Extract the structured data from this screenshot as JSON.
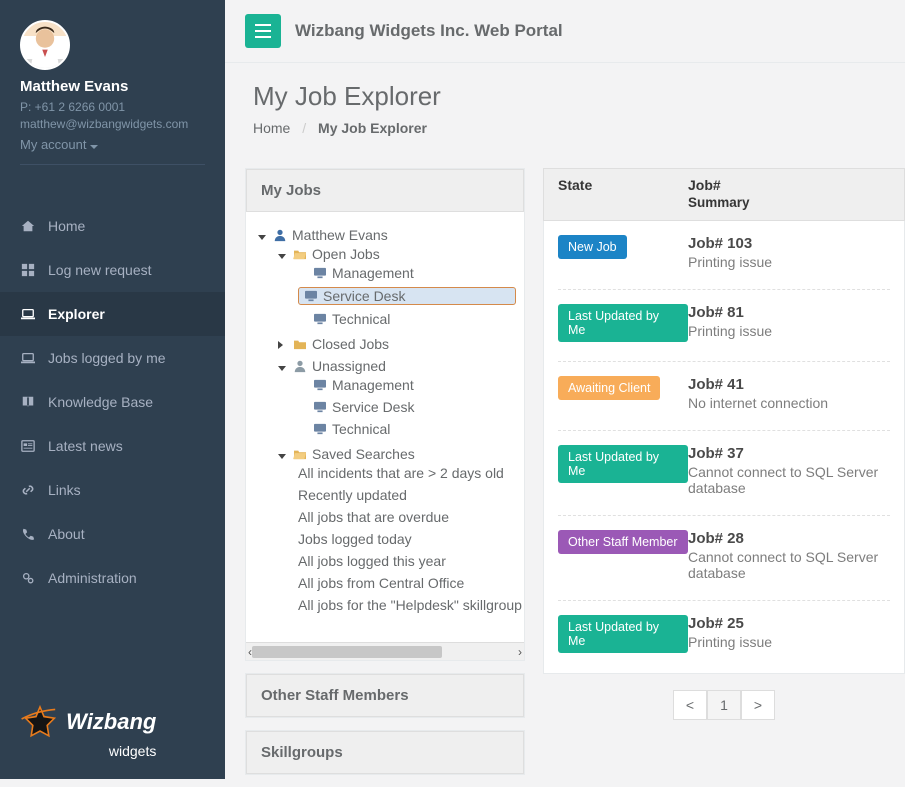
{
  "sidebar": {
    "profile": {
      "name": "Matthew Evans",
      "phone": "P: +61 2 6266 0001",
      "email": "matthew@wizbangwidgets.com",
      "account_label": "My account"
    },
    "nav": [
      {
        "label": "Home",
        "active": false
      },
      {
        "label": "Log new request",
        "active": false
      },
      {
        "label": "Explorer",
        "active": true
      },
      {
        "label": "Jobs logged by me",
        "active": false
      },
      {
        "label": "Knowledge Base",
        "active": false
      },
      {
        "label": "Latest news",
        "active": false
      },
      {
        "label": "Links",
        "active": false
      },
      {
        "label": "About",
        "active": false
      },
      {
        "label": "Administration",
        "active": false
      }
    ],
    "brand": {
      "top": "Wizbang",
      "bottom": "widgets"
    }
  },
  "topbar": {
    "title": "Wizbang Widgets Inc. Web Portal"
  },
  "page": {
    "title": "My Job Explorer",
    "breadcrumb_home": "Home",
    "breadcrumb_current": "My Job Explorer"
  },
  "tree": {
    "panel_title": "My Jobs",
    "root_user": "Matthew Evans",
    "open_jobs": "Open Jobs",
    "open_children": [
      "Management",
      "Service Desk",
      "Technical"
    ],
    "selected_index": 1,
    "closed_jobs": "Closed Jobs",
    "unassigned": "Unassigned",
    "unassigned_children": [
      "Management",
      "Service Desk",
      "Technical"
    ],
    "saved_searches": "Saved Searches",
    "saved_children": [
      "All incidents that are > 2 days old",
      "Recently updated",
      "All jobs that are overdue",
      "Jobs logged today",
      "All jobs logged this year",
      "All jobs from Central Office",
      "All jobs for the \"Helpdesk\" skillgroup"
    ]
  },
  "other_panel_title": "Other Staff Members",
  "skillgroups_title": "Skillgroups",
  "jobs": {
    "col_state": "State",
    "col_job": "Job#",
    "col_summary": "Summary",
    "rows": [
      {
        "state_class": "new",
        "state": "New Job",
        "num": "Job# 103",
        "summary": "Printing issue"
      },
      {
        "state_class": "lubm",
        "state": "Last Updated by Me",
        "num": "Job# 81",
        "summary": "Printing issue"
      },
      {
        "state_class": "await",
        "state": "Awaiting Client",
        "num": "Job# 41",
        "summary": "No internet connection"
      },
      {
        "state_class": "lubm",
        "state": "Last Updated by Me",
        "num": "Job# 37",
        "summary": "Cannot connect to SQL Server database"
      },
      {
        "state_class": "osm",
        "state": "Other Staff Member",
        "num": "Job# 28",
        "summary": "Cannot connect to SQL Server database"
      },
      {
        "state_class": "lubm",
        "state": "Last Updated by Me",
        "num": "Job# 25",
        "summary": "Printing issue"
      }
    ]
  },
  "pager": {
    "prev": "<",
    "page": "1",
    "next": ">"
  }
}
